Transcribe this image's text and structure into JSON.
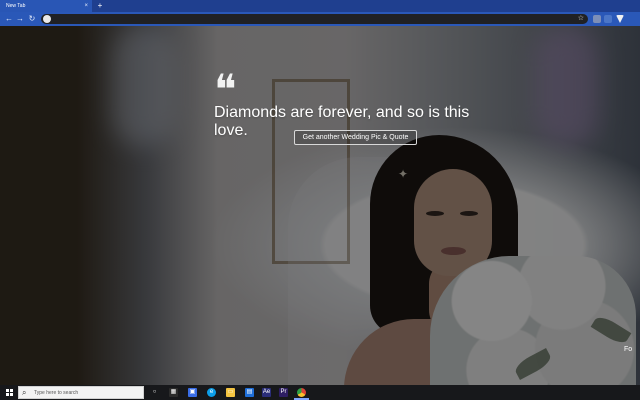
{
  "browser": {
    "tab_label": "New Tab",
    "tab_close": "×",
    "new_tab": "+",
    "back": "←",
    "forward": "→",
    "reload": "↻",
    "address_value": "",
    "bookmark_star": "☆"
  },
  "quote": {
    "icon": "❝",
    "text": "Diamonds are forever, and so is this love.",
    "button_label": "Get another Wedding Pic & Quote",
    "corner_text": "Fo"
  },
  "taskbar": {
    "search_placeholder": "Type here to search",
    "icons": [
      "search-icon",
      "task-view-icon",
      "widgets-icon",
      "edge-icon",
      "file-explorer-icon",
      "store-icon",
      "mail-icon",
      "after-effects-icon",
      "premiere-icon",
      "chrome-icon"
    ],
    "after_effects_label": "Ae",
    "premiere_label": "Pr"
  },
  "colors": {
    "browser_blue": "#2a58b8",
    "taskbar": "#17181b",
    "quote_text": "#ffffff"
  }
}
